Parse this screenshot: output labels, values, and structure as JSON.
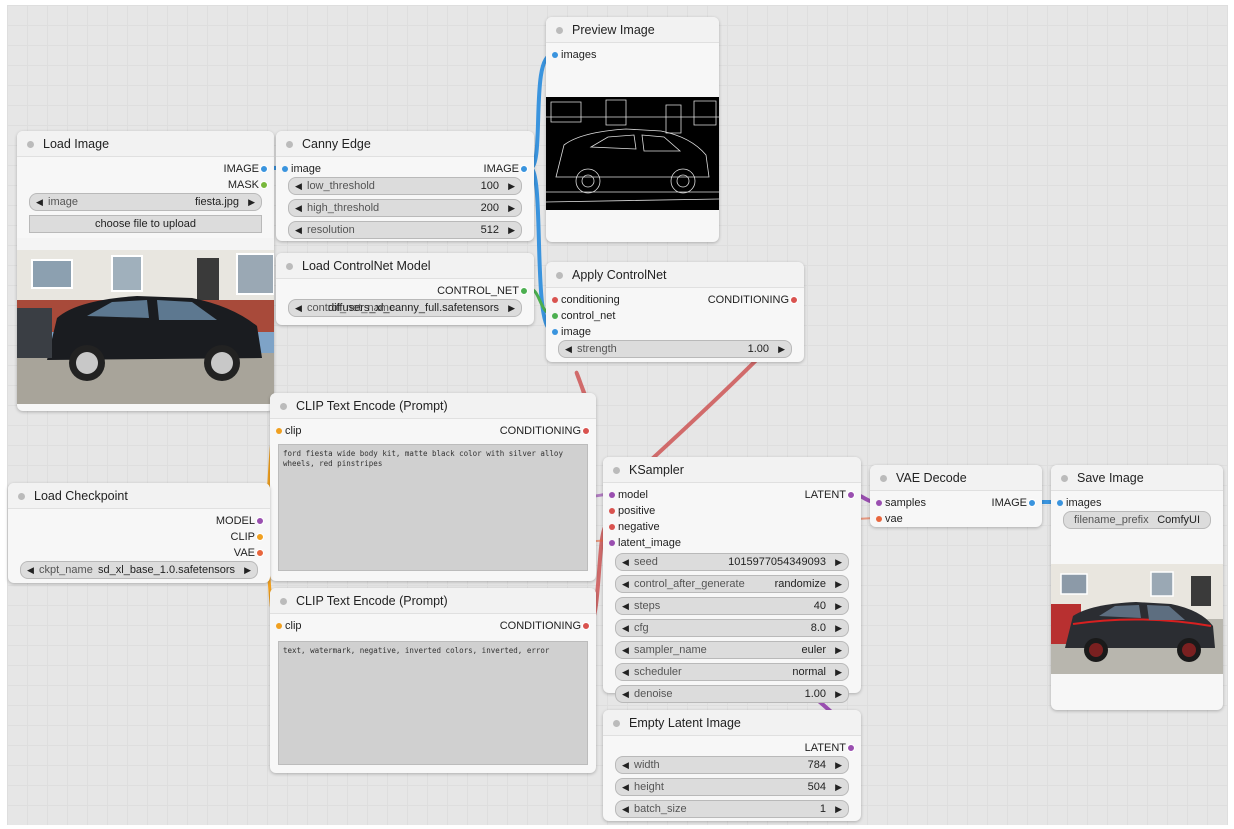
{
  "load_image": {
    "title": "Load Image",
    "out_image": "IMAGE",
    "out_mask": "MASK",
    "w_image_label": "image",
    "w_image_value": "fiesta.jpg",
    "upload_button": "choose file to upload"
  },
  "canny": {
    "title": "Canny Edge",
    "in_image": "image",
    "out_image": "IMAGE",
    "widgets": [
      {
        "label": "low_threshold",
        "value": "100"
      },
      {
        "label": "high_threshold",
        "value": "200"
      },
      {
        "label": "resolution",
        "value": "512"
      }
    ]
  },
  "controlnet_loader": {
    "title": "Load ControlNet Model",
    "out": "CONTROL_NET",
    "w_label": "control_net_name",
    "w_value": "diffusers_xl_canny_full.safetensors"
  },
  "preview": {
    "title": "Preview Image",
    "in_images": "images"
  },
  "apply_controlnet": {
    "title": "Apply ControlNet",
    "in_conditioning": "conditioning",
    "in_control_net": "control_net",
    "in_image": "image",
    "out": "CONDITIONING",
    "w_label": "strength",
    "w_value": "1.00"
  },
  "clip_pos": {
    "title": "CLIP Text Encode (Prompt)",
    "in_clip": "clip",
    "out": "CONDITIONING",
    "text": "ford fiesta wide body kit, matte black color with silver alloy wheels, red pinstripes"
  },
  "clip_neg": {
    "title": "CLIP Text Encode (Prompt)",
    "in_clip": "clip",
    "out": "CONDITIONING",
    "text": "text, watermark, negative, inverted colors, inverted, error"
  },
  "checkpoint": {
    "title": "Load Checkpoint",
    "out_model": "MODEL",
    "out_clip": "CLIP",
    "out_vae": "VAE",
    "w_label": "ckpt_name",
    "w_value": "sd_xl_base_1.0.safetensors"
  },
  "ksampler": {
    "title": "KSampler",
    "in_model": "model",
    "in_positive": "positive",
    "in_negative": "negative",
    "in_latent": "latent_image",
    "out": "LATENT",
    "widgets": [
      {
        "label": "seed",
        "value": "1015977054349093"
      },
      {
        "label": "control_after_generate",
        "value": "randomize"
      },
      {
        "label": "steps",
        "value": "40"
      },
      {
        "label": "cfg",
        "value": "8.0"
      },
      {
        "label": "sampler_name",
        "value": "euler"
      },
      {
        "label": "scheduler",
        "value": "normal"
      },
      {
        "label": "denoise",
        "value": "1.00"
      }
    ]
  },
  "empty_latent": {
    "title": "Empty Latent Image",
    "out": "LATENT",
    "widgets": [
      {
        "label": "width",
        "value": "784"
      },
      {
        "label": "height",
        "value": "504"
      },
      {
        "label": "batch_size",
        "value": "1"
      }
    ]
  },
  "vae_decode": {
    "title": "VAE Decode",
    "in_samples": "samples",
    "in_vae": "vae",
    "out": "IMAGE"
  },
  "save_image": {
    "title": "Save Image",
    "in_images": "images",
    "w_label": "filename_prefix",
    "w_value": "ComfyUI"
  },
  "colors": {
    "image_wire": "#3a94de",
    "cond_wire": "#d9534f",
    "latent_wire": "#9a4fb0",
    "clip_wire": "#f0a020",
    "vae_wire": "#e8663d"
  }
}
